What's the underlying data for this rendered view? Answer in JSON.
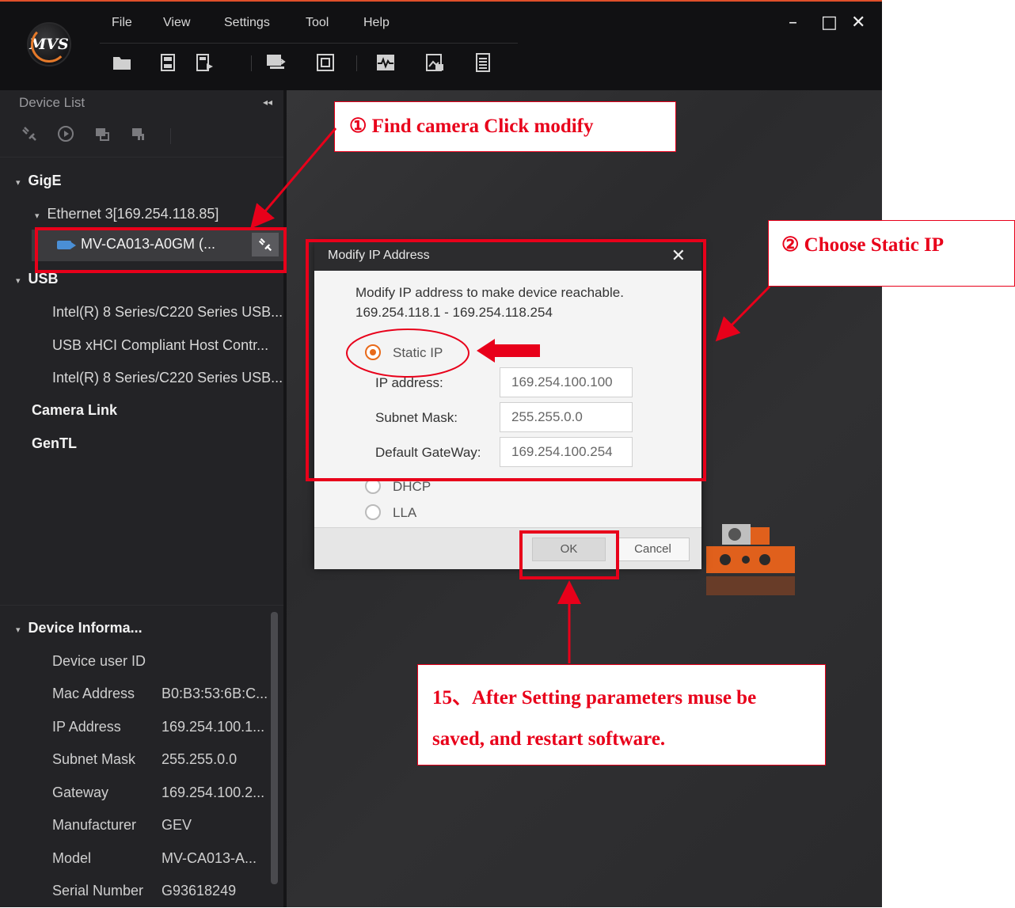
{
  "menu": {
    "file": "File",
    "view": "View",
    "settings": "Settings",
    "tool": "Tool",
    "help": "Help"
  },
  "logo": {
    "text": "MVS"
  },
  "toolbar_icons": [
    "open-folder-icon",
    "save-icon",
    "save-as-icon",
    "single-layout-icon",
    "multi-layout-icon",
    "waveform-icon",
    "image-icon",
    "list-icon"
  ],
  "window": {
    "minimize": "–",
    "maximize": "□",
    "close": "✕"
  },
  "sidebar": {
    "title": "Device List",
    "collapse": "◂◂",
    "gige": "GigE",
    "ethernet": "Ethernet 3[169.254.118.85]",
    "device": "MV-CA013-A0GM (...",
    "usb": "USB",
    "usb_items": [
      "Intel(R) 8 Series/C220 Series USB...",
      "USB xHCI Compliant Host Contr...",
      "Intel(R) 8 Series/C220 Series USB..."
    ],
    "camera_link": "Camera Link",
    "gentl": "GenTL"
  },
  "device_info": {
    "title": "Device Informa...",
    "rows": [
      {
        "key": "Device user ID",
        "value": ""
      },
      {
        "key": "Mac Address",
        "value": "B0:B3:53:6B:C..."
      },
      {
        "key": "IP Address",
        "value": "169.254.100.1..."
      },
      {
        "key": "Subnet Mask",
        "value": "255.255.0.0"
      },
      {
        "key": "Gateway",
        "value": "169.254.100.2..."
      },
      {
        "key": "Manufacturer",
        "value": "GEV"
      },
      {
        "key": "Model",
        "value": "MV-CA013-A..."
      },
      {
        "key": "Serial Number",
        "value": "G93618249"
      }
    ]
  },
  "dialog": {
    "title": "Modify IP Address",
    "close": "✕",
    "message": "Modify IP address to make device reachable.",
    "range": "169.254.118.1 - 169.254.118.254",
    "options": {
      "static": "Static IP",
      "dhcp": "DHCP",
      "lla": "LLA"
    },
    "selected": "static",
    "fields": {
      "ip_label": "IP address:",
      "ip_value": "169.254.100.100",
      "mask_label": "Subnet Mask:",
      "mask_value": "255.255.0.0",
      "gateway_label": "Default GateWay:",
      "gateway_value": "169.254.100.254"
    },
    "ok": "OK",
    "cancel": "Cancel"
  },
  "annotations": {
    "step1": "① Find camera Click modify",
    "step2": "② Choose Static IP",
    "step15_line1": "15、After Setting parameters muse be",
    "step15_line2": "saved, and restart software."
  },
  "colors": {
    "annotation_red": "#e8001a",
    "accent_orange": "#e86a1a",
    "device_icon_blue": "#4a8fd6"
  }
}
